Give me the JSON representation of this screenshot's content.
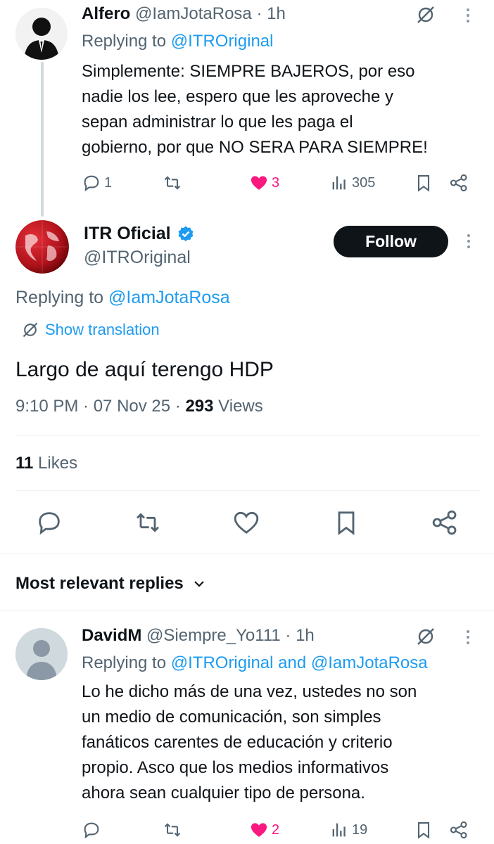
{
  "reply1": {
    "name": "Alfero",
    "handle": "@IamJotaRosa",
    "time": "· 1h",
    "replying_prefix": "Replying to ",
    "replying_to": "@ITROriginal",
    "text_lines": [
      "Simplemente: SIEMPRE BAJEROS, por eso",
      "nadie los lee, espero que les aproveche y",
      "sepan administrar lo que les paga el",
      "gobierno, por que NO SERA PARA SIEMPRE!"
    ],
    "replies": "1",
    "likes": "3",
    "views": "305"
  },
  "main": {
    "name": "ITR Oficial",
    "handle": "@ITROriginal",
    "follow_label": "Follow",
    "replying_prefix": "Replying to ",
    "replying_to": "@IamJotaRosa",
    "show_translation": "Show translation",
    "text": "Largo de aquí terengo HDP",
    "timestamp": "9:10 PM · 07 Nov 25 · ",
    "views_count": "293",
    "views_label": " Views",
    "likes_count": "11",
    "likes_label": " Likes"
  },
  "replies_header": {
    "label": "Most relevant replies"
  },
  "reply2": {
    "name": "DavidM",
    "handle": "@Siempre_Yo111",
    "time": "· 1h",
    "replying_prefix": "Replying to ",
    "replying_to": "@ITROriginal and @IamJotaRosa",
    "text_lines": [
      "Lo he dicho más de una vez, ustedes no son",
      "un medio de comunicación, son simples",
      "fanáticos carentes de educación y criterio",
      "propio. Asco que los medios informativos",
      "ahora sean cualquier tipo de persona."
    ],
    "likes": "2",
    "views": "19"
  },
  "colors": {
    "link": "#1d9bf0",
    "like": "#f91880",
    "secondary": "#536471",
    "follow_bg": "#0f1419"
  }
}
